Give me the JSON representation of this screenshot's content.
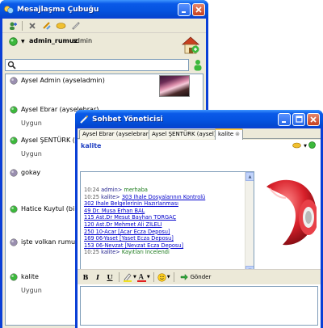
{
  "main_window": {
    "title": "Mesajlaşma Çubuğu",
    "current_user": {
      "username": "admin_rumuz",
      "role": "admin",
      "status_color": "#3cb83c"
    },
    "toolbar_icons": [
      "add-contact-icon",
      "delete-icon",
      "refresh-icon",
      "note-icon",
      "link-icon"
    ],
    "search": {
      "value": "",
      "placeholder": ""
    },
    "contacts": [
      {
        "name": "Aysel Admin (ayseladmin)",
        "status": "",
        "status_color": "#9a8fb0",
        "has_photo": true
      },
      {
        "name": "Aysel Ebrar (ayselebrar)",
        "status": "Uygun",
        "status_color": "#3cb83c"
      },
      {
        "name": "Aysel ŞENTÜRK (aysel)",
        "status": "Uygun",
        "status_color": "#3cb83c"
      },
      {
        "name": "gokay",
        "status": "",
        "status_color": "#9a8fb0"
      },
      {
        "name": "Hatice Kuytul (bilgisler",
        "status": "",
        "status_color": "#3cb83c"
      },
      {
        "name": "işte volkan rumuzu (vo",
        "status": "",
        "status_color": "#9a8fb0"
      },
      {
        "name": "kalite",
        "status": "Uygun",
        "status_color": "#3cb83c"
      }
    ]
  },
  "chat_window": {
    "title": "Sohbet Yöneticisi",
    "tabs": [
      {
        "label": "Aysel Ebrar (ayselebrar)",
        "active": false
      },
      {
        "label": "Aysel ŞENTÜRK (aysel)",
        "active": false
      },
      {
        "label": "kalite",
        "active": true
      }
    ],
    "contact_name": "kalite",
    "messages": [
      {
        "time": "10:24",
        "sender": "admin>",
        "text": "merhaba",
        "link": false
      },
      {
        "time": "10:25",
        "sender": "kalite>",
        "text": "303 İhale Dosyalarının Kontrolü",
        "link": true
      },
      {
        "time": "",
        "sender": "",
        "text": "302 İhale Belgelerinin Hazırlanması",
        "link": true
      },
      {
        "time": "",
        "sender": "",
        "text": "49 Dr. Musa Erhan BAL",
        "link": true
      },
      {
        "time": "",
        "sender": "",
        "text": "115 Ast.Dr Mesut Bayhan TORGAÇ",
        "link": true
      },
      {
        "time": "",
        "sender": "",
        "text": "120 Ast.Dr Mehmet Ali ZİLELİ",
        "link": true
      },
      {
        "time": "",
        "sender": "",
        "text": "250 10-Acar [Acar Ecza Deposu]",
        "link": true
      },
      {
        "time": "",
        "sender": "",
        "text": "169 06-Yaset [Yaset Ecza Deposu]",
        "link": true
      },
      {
        "time": "",
        "sender": "",
        "text": "153 06-Nevzat [Nevzat Ecza Deposu]",
        "link": true
      },
      {
        "time": "10:25",
        "sender": "kalite>",
        "text": "Kayıtları İncelendi",
        "link": false
      }
    ],
    "format_toolbar": {
      "bold": "B",
      "italic": "I",
      "underline": "U",
      "send_label": "Gönder"
    },
    "input": {
      "value": ""
    }
  },
  "colors": {
    "title_blue": "#0553e0",
    "window_bg": "#ece9d8",
    "link": "#0000cc",
    "contact_name": "#1e3ec2"
  }
}
